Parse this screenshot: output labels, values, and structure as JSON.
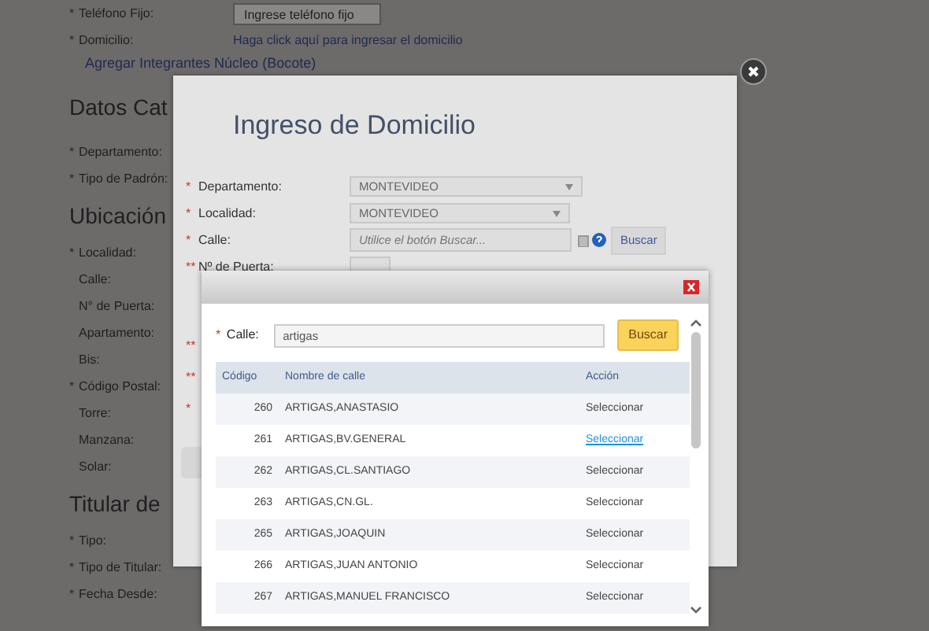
{
  "background_form": {
    "rows": [
      {
        "kind": "field",
        "marker": "*",
        "label": "Teléfono Fijo:",
        "placeholder": "Ingrese teléfono fijo"
      },
      {
        "kind": "link",
        "marker": "*",
        "label": "Domicilio:",
        "link": "Haga click aquí para ingresar el domicilio"
      },
      {
        "kind": "action",
        "label": "Agregar Integrantes Núcleo (Bocote)"
      },
      {
        "kind": "heading",
        "label": "Datos Cat"
      },
      {
        "kind": "label",
        "marker": "*",
        "label": "Departamento:"
      },
      {
        "kind": "label",
        "marker": "*",
        "label": "Tipo de Padrón:"
      },
      {
        "kind": "heading",
        "label": "Ubicación"
      },
      {
        "kind": "label",
        "marker": "*",
        "label": "Localidad:"
      },
      {
        "kind": "label",
        "label": "Calle:"
      },
      {
        "kind": "label",
        "label": "N° de Puerta:"
      },
      {
        "kind": "label",
        "label": "Apartamento:"
      },
      {
        "kind": "label",
        "label": "Bis:"
      },
      {
        "kind": "label",
        "marker": "*",
        "label": "Código Postal:"
      },
      {
        "kind": "label",
        "label": "Torre:"
      },
      {
        "kind": "label",
        "label": "Manzana:"
      },
      {
        "kind": "label",
        "label": "Solar:"
      },
      {
        "kind": "heading",
        "label": "Titular de"
      },
      {
        "kind": "label",
        "marker": "*",
        "label": "Tipo:"
      },
      {
        "kind": "label",
        "marker": "*",
        "label": "Tipo de Titular:"
      },
      {
        "kind": "label",
        "marker": "*",
        "label": "Fecha Desde:"
      }
    ]
  },
  "address_dialog": {
    "title": "Ingreso de Domicilio",
    "rows": [
      {
        "kind": "select",
        "marker": "*",
        "label": "Departamento:",
        "value": "MONTEVIDEO"
      },
      {
        "kind": "select",
        "marker": "*",
        "label": "Localidad:",
        "value": "MONTEVIDEO"
      },
      {
        "kind": "search",
        "marker": "*",
        "label": "Calle:",
        "placeholder": "Utilice el botón Buscar...",
        "button": "Buscar"
      },
      {
        "kind": "small_input",
        "marker": "**",
        "label": "Nº de Puerta:"
      },
      {
        "kind": "hidden",
        "marker": "**"
      },
      {
        "kind": "hidden",
        "marker": "**"
      },
      {
        "kind": "hidden",
        "marker": "*"
      }
    ]
  },
  "street_search": {
    "marker": "*",
    "label": "Calle:",
    "value": "artigas",
    "button": "Buscar",
    "columns": [
      "Código",
      "Nombre de calle",
      "Acción"
    ],
    "rows": [
      {
        "code": "260",
        "name": "ARTIGAS,ANASTASIO",
        "action": "Seleccionar",
        "hovered": false
      },
      {
        "code": "261",
        "name": "ARTIGAS,BV.GENERAL",
        "action": "Seleccionar",
        "hovered": true
      },
      {
        "code": "262",
        "name": "ARTIGAS,CL.SANTIAGO",
        "action": "Seleccionar",
        "hovered": false
      },
      {
        "code": "263",
        "name": "ARTIGAS,CN.GL.",
        "action": "Seleccionar",
        "hovered": false
      },
      {
        "code": "265",
        "name": "ARTIGAS,JOAQUIN",
        "action": "Seleccionar",
        "hovered": false
      },
      {
        "code": "266",
        "name": "ARTIGAS,JUAN ANTONIO",
        "action": "Seleccionar",
        "hovered": false
      },
      {
        "code": "267",
        "name": "ARTIGAS,MANUEL FRANCISCO",
        "action": "Seleccionar",
        "hovered": false
      }
    ]
  }
}
